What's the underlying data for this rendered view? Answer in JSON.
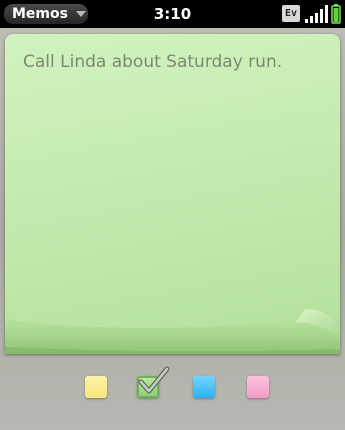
{
  "status_bar": {
    "app_menu_label": "Memos",
    "time": "3:10",
    "network": "Ev"
  },
  "memo": {
    "text": "Call Linda about Saturday run.",
    "color": "#c6ecb0"
  },
  "colors": {
    "yellow": "#f6e57a",
    "green": "#8ed173",
    "blue": "#2eb0f2",
    "pink": "#f39cc7",
    "selected": "green"
  }
}
